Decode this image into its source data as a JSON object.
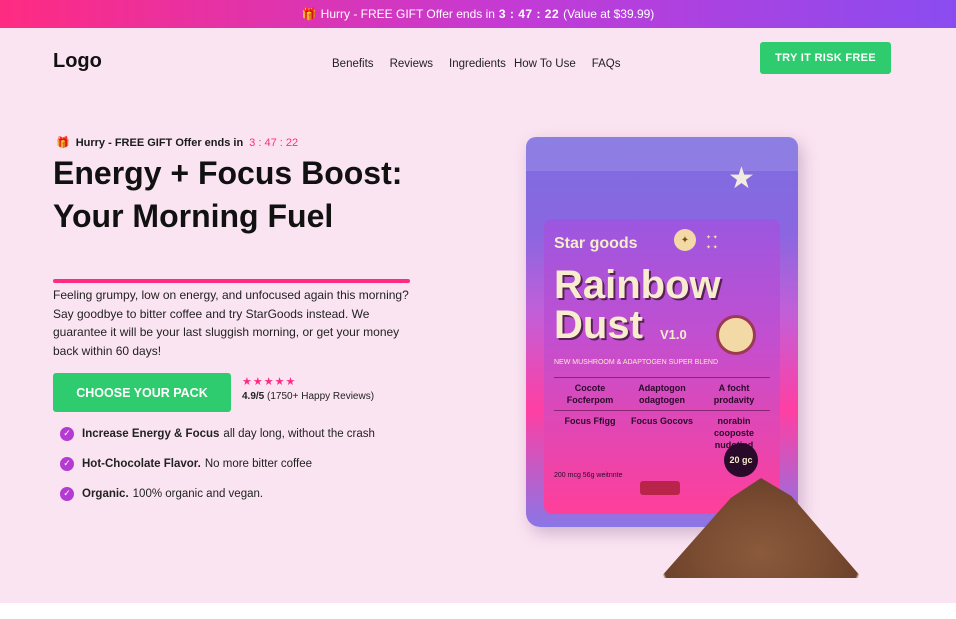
{
  "topbar": {
    "gift_icon": "🎁",
    "text": "Hurry - FREE GIFT Offer ends in",
    "timer": "3 : 47 : 22",
    "value_note": "(Value at $39.99)"
  },
  "header": {
    "logo": "Logo",
    "nav": [
      "Benefits",
      "Reviews",
      "Ingredients",
      "How To Use",
      "FAQs"
    ],
    "cta": "TRY IT RISK FREE"
  },
  "hero": {
    "offer_icon": "🎁",
    "offer_text": "Hurry - FREE GIFT Offer ends in",
    "offer_timer": "3 : 47 : 22",
    "headline": "Energy + Focus Boost: Your Morning Fuel",
    "description": "Feeling grumpy, low on energy, and unfocused again this morning? Say goodbye to bitter coffee and try StarGoods instead. We guarantee it will be your last sluggish morning, or get your money back within 60 days!",
    "choose_button": "CHOOSE YOUR PACK",
    "stars": "★★★★★",
    "rating_value": "4.9/5",
    "rating_count": "(1750+ Happy Reviews)",
    "benefits": [
      {
        "bold": "Increase Energy & Focus",
        "rest": "all day long, without the crash"
      },
      {
        "bold": "Hot-Chocolate Flavor.",
        "rest": "No more bitter coffee"
      },
      {
        "bold": "Organic.",
        "rest": "100% organic and vegan."
      }
    ]
  },
  "product": {
    "brand": "Star goods",
    "name": "Rainbow Dust",
    "version": "V1.0",
    "subtitle": "NEW MUSHROOM & ADAPTOGEN SUPER BLEND",
    "grid": [
      [
        "Cocote Focferpom",
        "Adaptogon odagtogen",
        "A focht prodavity"
      ],
      [
        "Focus Ffigg",
        "Focus Gocovs",
        "norabin cooposte nudotind"
      ]
    ],
    "weight": "20 gc",
    "net_text": "200 mcg 56g weitnnte"
  }
}
